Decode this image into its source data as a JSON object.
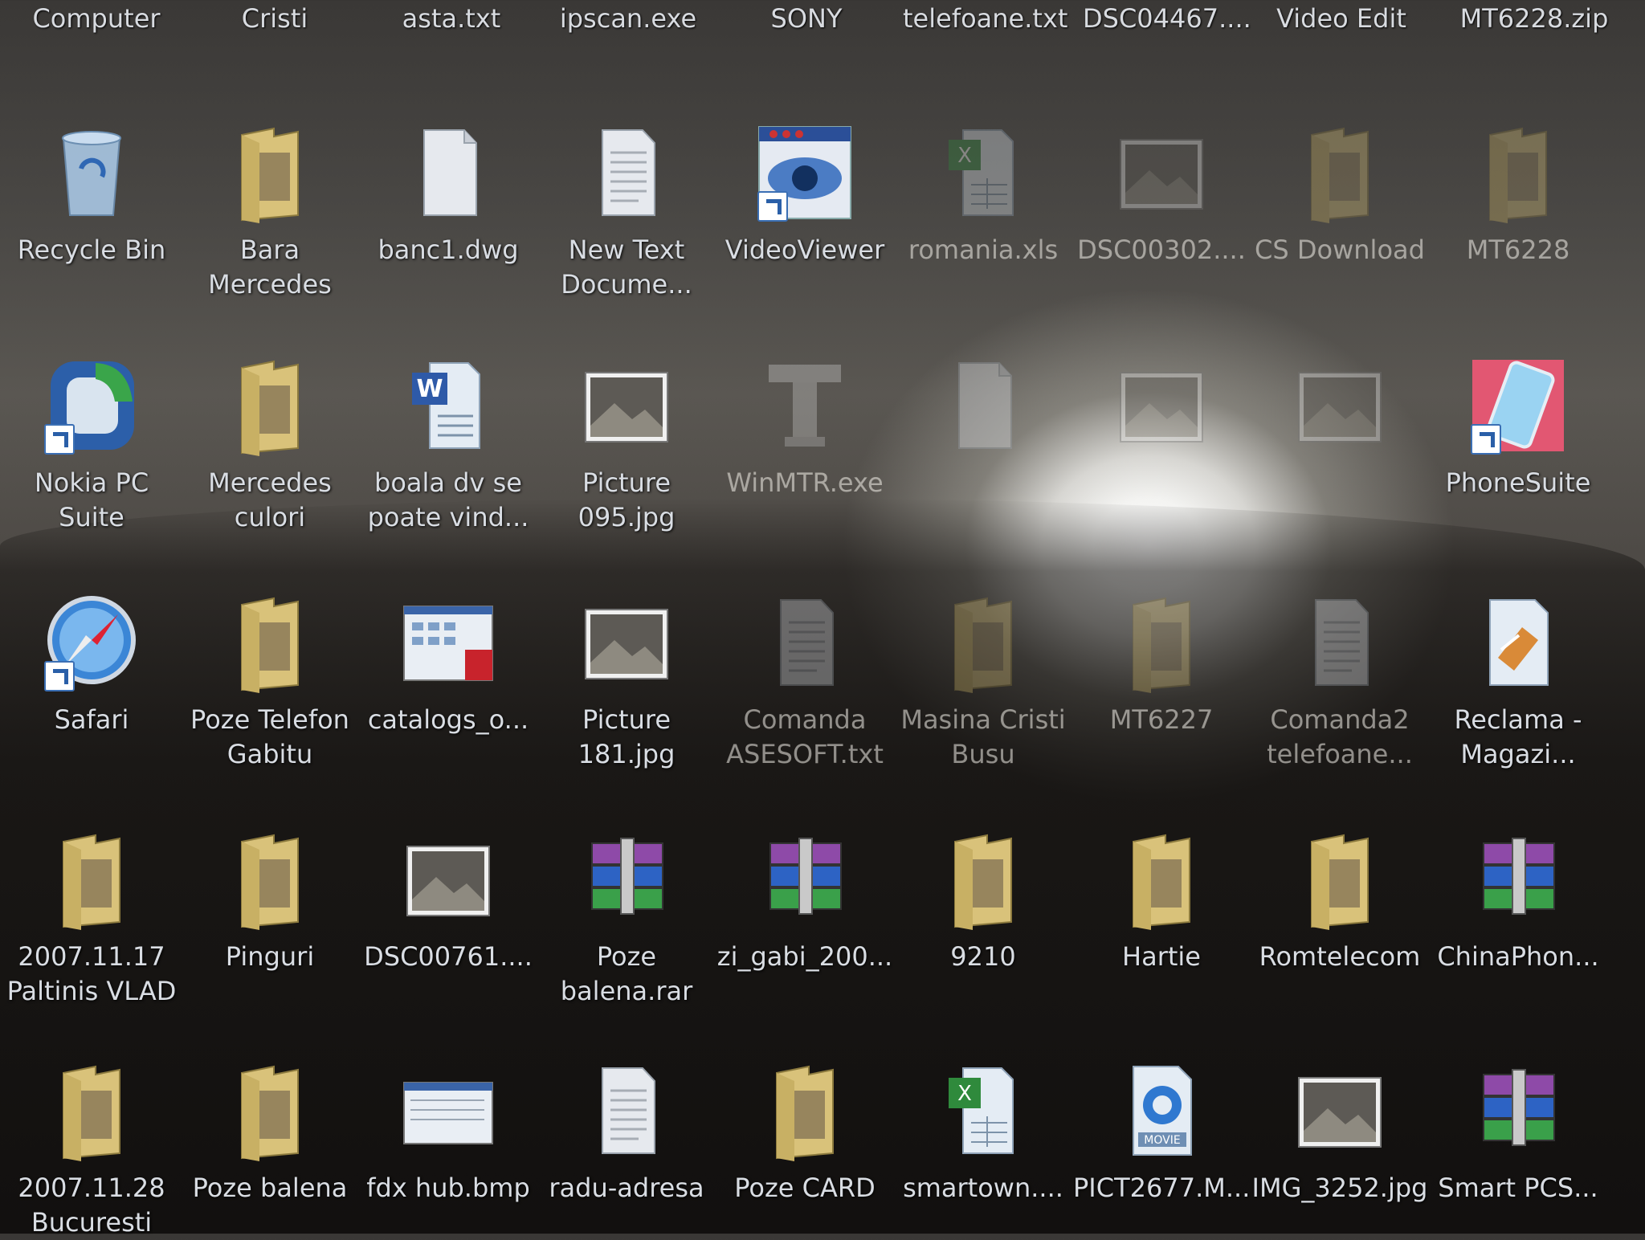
{
  "top_row": [
    "Computer",
    "Cristi",
    "asta.txt",
    "ipscan.exe",
    "SONY",
    "telefoane.txt",
    "DSC04467....",
    "Video Edit",
    "MT6228.zip"
  ],
  "rows": [
    [
      {
        "label": "Recycle Bin",
        "icon": "recycle-bin-icon"
      },
      {
        "label": "Bara\nMercedes",
        "icon": "folder-icon"
      },
      {
        "label": "banc1.dwg",
        "icon": "file-icon"
      },
      {
        "label": "New Text\nDocume...",
        "icon": "text-file-icon"
      },
      {
        "label": "VideoViewer",
        "icon": "video-viewer-icon",
        "shortcut": true
      },
      {
        "label": "romania.xls",
        "icon": "excel-file-icon"
      },
      {
        "label": "DSC00302....",
        "icon": "image-file-icon"
      },
      {
        "label": "CS Download",
        "icon": "folder-icon"
      },
      {
        "label": "MT6228",
        "icon": "folder-icon"
      }
    ],
    [
      {
        "label": "Nokia PC\nSuite",
        "icon": "nokia-pc-suite-icon",
        "shortcut": true
      },
      {
        "label": "Mercedes\nculori",
        "icon": "folder-icon"
      },
      {
        "label": "boala dv se\npoate vind...",
        "icon": "word-document-icon"
      },
      {
        "label": "Picture\n095.jpg",
        "icon": "image-file-icon"
      },
      {
        "label": "WinMTR.exe",
        "icon": "network-app-icon"
      },
      {
        "label": "",
        "icon": "file-icon"
      },
      {
        "label": "",
        "icon": "image-file-icon"
      },
      {
        "label": "",
        "icon": "image-file-icon"
      },
      {
        "label": "PhoneSuite",
        "icon": "phone-suite-icon",
        "shortcut": true
      }
    ],
    [
      {
        "label": "Safari",
        "icon": "safari-compass-icon",
        "shortcut": true
      },
      {
        "label": "Poze Telefon\nGabitu",
        "icon": "folder-icon"
      },
      {
        "label": "catalogs_o...",
        "icon": "pdf-file-icon"
      },
      {
        "label": "Picture\n181.jpg",
        "icon": "image-file-icon"
      },
      {
        "label": "Comanda\nASESOFT.txt",
        "icon": "text-file-icon"
      },
      {
        "label": "Masina Cristi\nBusu",
        "icon": "folder-icon"
      },
      {
        "label": "MT6227",
        "icon": "folder-icon"
      },
      {
        "label": "Comanda2\ntelefoane...",
        "icon": "text-file-icon"
      },
      {
        "label": "Reclama -\nMagazi...",
        "icon": "sketch-file-icon"
      }
    ],
    [
      {
        "label": "2007.11.17\nPaltinis VLAD",
        "icon": "folder-icon"
      },
      {
        "label": "Pinguri",
        "icon": "folder-icon"
      },
      {
        "label": "DSC00761....",
        "icon": "image-file-icon"
      },
      {
        "label": "Poze\nbalena.rar",
        "icon": "winrar-archive-icon"
      },
      {
        "label": "zi_gabi_200...",
        "icon": "winrar-archive-icon"
      },
      {
        "label": "9210",
        "icon": "folder-icon"
      },
      {
        "label": "Hartie",
        "icon": "folder-icon"
      },
      {
        "label": "Romtelecom",
        "icon": "folder-icon"
      },
      {
        "label": "ChinaPhon...",
        "icon": "winrar-archive-icon"
      }
    ],
    [
      {
        "label": "2007.11.28\nBucuresti",
        "icon": "folder-icon"
      },
      {
        "label": "Poze balena",
        "icon": "folder-icon"
      },
      {
        "label": "fdx hub.bmp",
        "icon": "bitmap-file-icon"
      },
      {
        "label": "radu-adresa",
        "icon": "text-file-icon"
      },
      {
        "label": "Poze CARD",
        "icon": "folder-icon"
      },
      {
        "label": "smartown....",
        "icon": "excel-file-icon"
      },
      {
        "label": "PICT2677.M...",
        "icon": "quicktime-movie-icon"
      },
      {
        "label": "IMG_3252.jpg",
        "icon": "image-file-icon"
      },
      {
        "label": "Smart PCS...",
        "icon": "winrar-archive-icon"
      }
    ]
  ]
}
